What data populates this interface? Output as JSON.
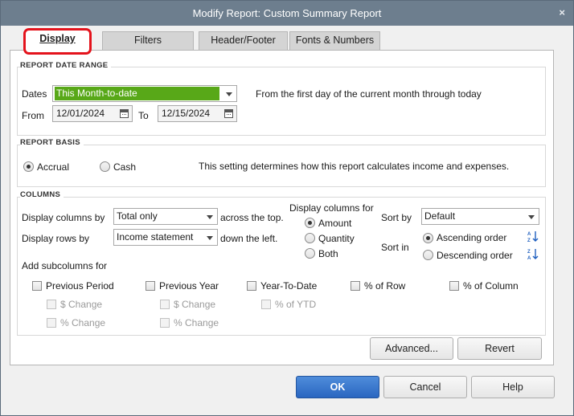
{
  "window": {
    "title": "Modify Report: Custom Summary Report",
    "close_glyph": "×"
  },
  "tabs": [
    {
      "label": "Display",
      "active": true
    },
    {
      "label": "Filters"
    },
    {
      "label": "Header/Footer"
    },
    {
      "label": "Fonts & Numbers"
    }
  ],
  "date_range": {
    "section_title": "REPORT DATE RANGE",
    "dates_label": "Dates",
    "dates_value": "This Month-to-date",
    "description": "From the first day of the current month through today",
    "from_label": "From",
    "from_value": "12/01/2024",
    "to_label": "To",
    "to_value": "12/15/2024"
  },
  "report_basis": {
    "section_title": "REPORT BASIS",
    "accrual_label": "Accrual",
    "cash_label": "Cash",
    "selected": "Accrual",
    "description": "This setting determines how this report calculates income and expenses."
  },
  "columns": {
    "section_title": "COLUMNS",
    "display_columns_label": "Display columns by",
    "display_columns_value": "Total only",
    "across_label": "across the top.",
    "display_rows_label": "Display rows by",
    "display_rows_value": "Income statement",
    "down_label": "down the left.",
    "display_columns_for_label": "Display columns for",
    "amount_label": "Amount",
    "quantity_label": "Quantity",
    "both_label": "Both",
    "columns_for_selected": "Amount",
    "sort_by_label": "Sort by",
    "sort_by_value": "Default",
    "sort_in_label": "Sort in",
    "ascending_label": "Ascending order",
    "descending_label": "Descending order",
    "sort_selected": "Ascending order",
    "add_subcolumns_label": "Add subcolumns for",
    "subcolumns": {
      "previous_period": {
        "label": "Previous Period",
        "dollar_change": "$ Change",
        "percent_change": "% Change"
      },
      "previous_year": {
        "label": "Previous Year",
        "dollar_change": "$ Change",
        "percent_change": "% Change"
      },
      "year_to_date": {
        "label": "Year-To-Date",
        "percent_ytd": "% of YTD"
      },
      "percent_row": {
        "label": "% of Row"
      },
      "percent_column": {
        "label": "% of Column"
      }
    }
  },
  "panel_buttons": {
    "advanced": "Advanced...",
    "revert": "Revert"
  },
  "dialog_buttons": {
    "ok": "OK",
    "cancel": "Cancel",
    "help": "Help"
  },
  "colors": {
    "titlebar": "#6d7e8e",
    "selected_value_bg": "#58a818",
    "highlight_ring": "#e4131c",
    "primary_button": "#2a66c0"
  }
}
